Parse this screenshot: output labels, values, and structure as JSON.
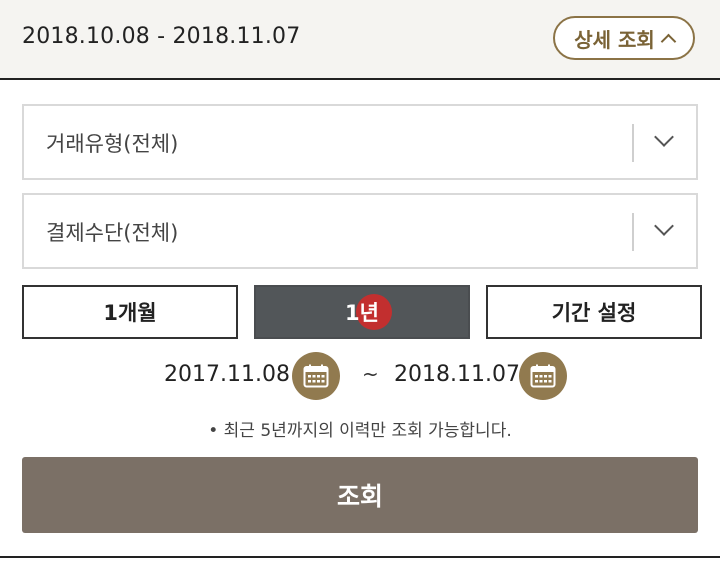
{
  "header": {
    "date_range": "2018.10.08 - 2018.11.07",
    "detail_button_label": "상세 조회"
  },
  "filters": {
    "transaction_type": "거래유형(전체)",
    "payment_method": "결제수단(전체)"
  },
  "period": {
    "options": [
      "1개월",
      "1년",
      "기간 설정"
    ],
    "selected": "1년",
    "start_date": "2017.11.08",
    "separator": "~",
    "end_date": "2018.11.07"
  },
  "notice": "• 최근 5년까지의 이력만 조회 가능합니다.",
  "search_button_label": "조회",
  "colors": {
    "accent_gold": "#917a4f",
    "active_period": "#525659",
    "search_button": "#7b7066",
    "touch_indicator": "#d62828"
  }
}
